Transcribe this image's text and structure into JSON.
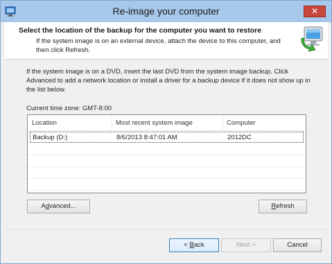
{
  "window": {
    "title": "Re-image your computer",
    "close_label": "✕"
  },
  "header": {
    "title": "Select the location of the backup for the computer you want to restore",
    "description": "If the system image is on an external device, attach the device to this computer, and then click Refresh."
  },
  "instructions": "If the system image is on a DVD, insert the last DVD from the system image backup. Click Advanced to add a network location or install a driver for a backup device if it does not show up in the list below.",
  "timezone": "Current time zone: GMT-8:00",
  "table": {
    "columns": [
      "Location",
      "Most recent system image",
      "Computer"
    ],
    "rows": [
      [
        "Backup (D:)",
        "8/6/2013 8:47:01 AM",
        "2012DC"
      ]
    ]
  },
  "buttons": {
    "advanced_pre": "A",
    "advanced_ul": "d",
    "advanced_post": "vanced...",
    "refresh_ul": "R",
    "refresh_post": "efresh",
    "back_pre": "< ",
    "back_ul": "B",
    "back_post": "ack",
    "next": "Next >",
    "cancel": "Cancel"
  },
  "icons": {
    "window_icon": "reimage-icon",
    "header_icon": "computer-restore-icon"
  },
  "colors": {
    "titlebar": "#a7c8ea",
    "close": "#c7463a"
  }
}
